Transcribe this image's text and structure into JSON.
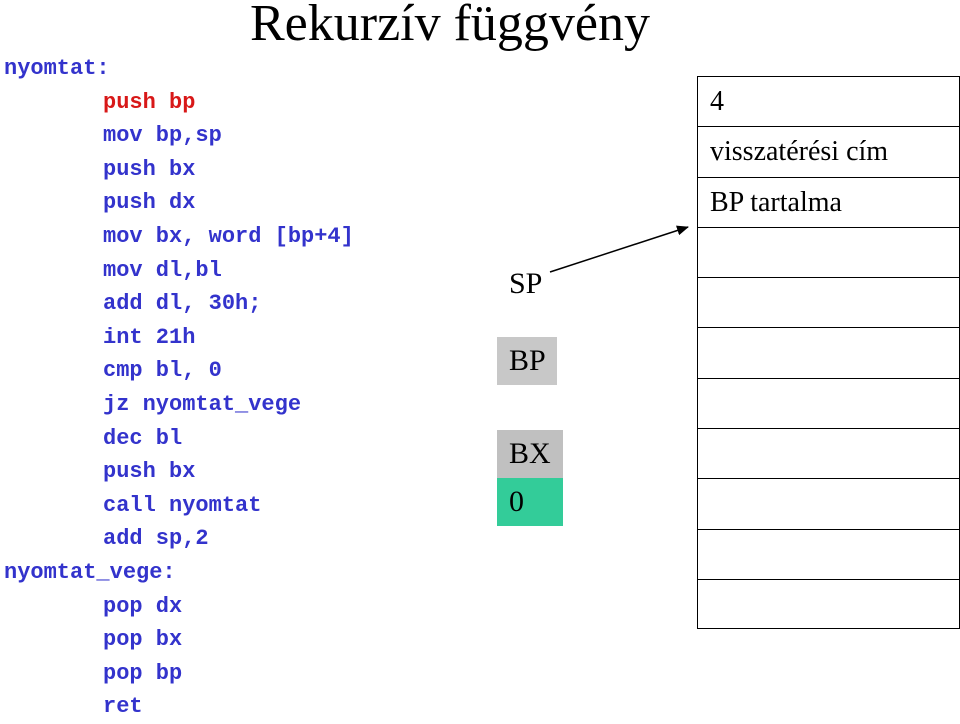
{
  "title": "Rekurzív függvény",
  "code": [
    {
      "text": "nyomtat:",
      "type": "label",
      "highlight": false
    },
    {
      "text": "push bp",
      "type": "instr",
      "highlight": true
    },
    {
      "text": "mov bp,sp",
      "type": "instr",
      "highlight": false
    },
    {
      "text": "push bx",
      "type": "instr",
      "highlight": false
    },
    {
      "text": "push dx",
      "type": "instr",
      "highlight": false
    },
    {
      "text": "mov bx, word [bp+4]",
      "type": "instr",
      "highlight": false
    },
    {
      "text": "mov dl,bl",
      "type": "instr",
      "highlight": false
    },
    {
      "text": "add dl, 30h;",
      "type": "instr",
      "highlight": false
    },
    {
      "text": "int 21h",
      "type": "instr",
      "highlight": false
    },
    {
      "text": "cmp bl, 0",
      "type": "instr",
      "highlight": false
    },
    {
      "text": "jz nyomtat_vege",
      "type": "instr",
      "highlight": false
    },
    {
      "text": "dec bl",
      "type": "instr",
      "highlight": false
    },
    {
      "text": "push bx",
      "type": "instr",
      "highlight": false
    },
    {
      "text": "call nyomtat",
      "type": "instr",
      "highlight": false
    },
    {
      "text": "add sp,2",
      "type": "instr",
      "highlight": false
    },
    {
      "text": "nyomtat_vege:",
      "type": "label",
      "highlight": false
    },
    {
      "text": "pop dx",
      "type": "instr",
      "highlight": false
    },
    {
      "text": "pop bx",
      "type": "instr",
      "highlight": false
    },
    {
      "text": "pop bp",
      "type": "instr",
      "highlight": false
    },
    {
      "text": "ret",
      "type": "instr",
      "highlight": false
    }
  ],
  "registers": {
    "sp": "SP",
    "bp": "BP",
    "bx": "BX",
    "bx_value": "0"
  },
  "stack": [
    "4",
    "visszatérési cím",
    "BP tartalma",
    "",
    "",
    "",
    "",
    "",
    "",
    "",
    ""
  ],
  "colors": {
    "code": "#3333cc",
    "highlight": "#d81818",
    "bp_box": "#c8c8c8",
    "bx_box": "#c0c0c0",
    "value_box": "#33cc99"
  }
}
